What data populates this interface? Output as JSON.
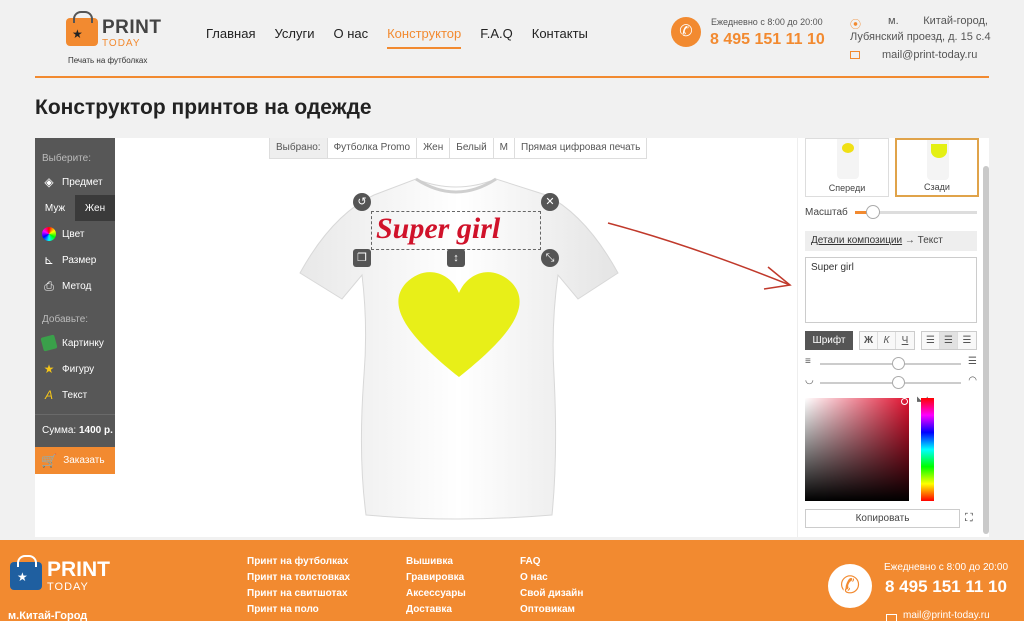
{
  "header": {
    "logo": {
      "print": "PRINT",
      "today": "TODAY",
      "subtitle": "Печать на футболках"
    },
    "nav": [
      {
        "label": "Главная",
        "active": false
      },
      {
        "label": "Услуги",
        "active": false
      },
      {
        "label": "О нас",
        "active": false
      },
      {
        "label": "Конструктор",
        "active": true
      },
      {
        "label": "F.A.Q",
        "active": false
      },
      {
        "label": "Контакты",
        "active": false
      }
    ],
    "hours": "Ежедневно с 8:00 до 20:00",
    "phone": "8 495 151 11 10",
    "address_line1": "м. Китай-город,",
    "address_line2": "Лубянский проезд, д. 15 с.4",
    "email": "mail@print-today.ru"
  },
  "page": {
    "title": "Конструктор принтов на одежде"
  },
  "left_panel": {
    "choose_label": "Выберите:",
    "item_label": "Предмет",
    "gender": {
      "male": "Муж",
      "female": "Жен",
      "selected": "Жен"
    },
    "color_label": "Цвет",
    "size_label": "Размер",
    "method_label": "Метод",
    "add_label": "Добавьте:",
    "picture_label": "Картинку",
    "shape_label": "Фигуру",
    "text_label": "Текст",
    "sum_label": "Сумма:",
    "sum_value": "1400 р.",
    "order_label": "Заказать"
  },
  "selected_bar": {
    "label": "Выбрано:",
    "product": "Футболка Promo",
    "gender": "Жен",
    "color": "Белый",
    "size": "M",
    "method": "Прямая цифровая печать"
  },
  "canvas": {
    "print_text": "Super girl",
    "print_color": "#d0122a",
    "heart_color": "#e8ef18"
  },
  "right_panel": {
    "views": [
      {
        "label": "Спереди",
        "selected": false
      },
      {
        "label": "Сзади",
        "selected": true
      }
    ],
    "scale_label": "Масштаб",
    "scale_value": 0.15,
    "crumb_link": "Детали композиции",
    "crumb_current": "→ Текст",
    "text_value": "Super girl",
    "font_button": "Шрифт",
    "style_buttons": [
      "Ж",
      "К",
      "Ч"
    ],
    "align_buttons": [
      "align-left-icon",
      "align-center-icon",
      "align-right-icon"
    ],
    "line_spacing_value": 0.55,
    "arc_value": 0.55,
    "picker_color": "#e0112f",
    "copy_label": "Копировать"
  },
  "footer": {
    "logo": {
      "print": "PRINT",
      "today": "TODAY"
    },
    "metro": "м.Китай-Город",
    "col1": [
      "Принт на футболках",
      "Принт на толстовках",
      "Принт на свитшотах",
      "Принт на поло"
    ],
    "col2": [
      "Вышивка",
      "Гравировка",
      "Аксессуары",
      "Доставка"
    ],
    "col3": [
      "FAQ",
      "О нас",
      "Свой дизайн",
      "Оптовикам"
    ],
    "hours": "Ежедневно с 8:00 до 20:00",
    "phone": "8 495 151 11 10",
    "email": "mail@print-today.ru"
  },
  "colors": {
    "accent": "#f28a30",
    "panel": "#575757"
  }
}
